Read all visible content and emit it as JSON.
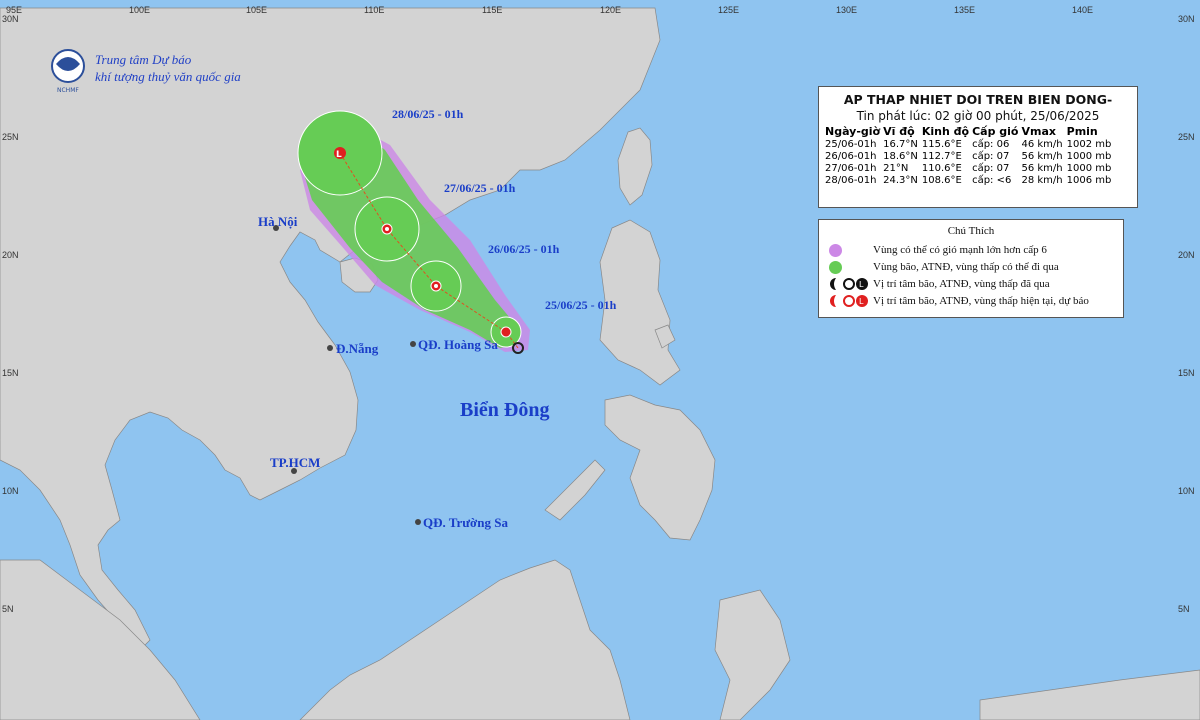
{
  "agency": {
    "name_line1": "Trung tâm Dự báo",
    "name_line2": "khí tượng thuỷ văn quốc gia",
    "logo_text": "NCHMF"
  },
  "axes": {
    "longitude_labels": [
      "95E",
      "100E",
      "105E",
      "110E",
      "115E",
      "120E",
      "125E",
      "130E",
      "135E",
      "140E"
    ],
    "latitude_labels": [
      "30N",
      "25N",
      "20N",
      "15N",
      "10N",
      "5N"
    ]
  },
  "info": {
    "title": "AP THAP NHIET DOI TREN BIEN DONG-",
    "issued": "Tin phát lúc: 02 giờ 00 phút, 25/06/2025",
    "headers": [
      "Ngày-giờ",
      "Vĩ độ",
      "Kinh độ",
      "Cấp gió",
      "Vmax",
      "Pmin"
    ],
    "rows": [
      [
        "25/06-01h",
        "16.7°N",
        "115.6°E",
        "cấp: 06",
        "46 km/h",
        "1002 mb"
      ],
      [
        "26/06-01h",
        "18.6°N",
        "112.7°E",
        "cấp: 07",
        "56 km/h",
        "1000 mb"
      ],
      [
        "27/06-01h",
        "21°N",
        "110.6°E",
        "cấp: 07",
        "56 km/h",
        "1000 mb"
      ],
      [
        "28/06-01h",
        "24.3°N",
        "108.6°E",
        "cấp: <6",
        "28 km/h",
        "1006 mb"
      ]
    ]
  },
  "legend": {
    "title": "Chú Thích",
    "items": [
      {
        "text": "Vùng có thể có gió mạnh lớn hơn cấp 6",
        "color": "#cc88e6"
      },
      {
        "text": "Vùng bão, ATNĐ, vùng thấp có thể đi qua",
        "color": "#66cc55"
      },
      {
        "text": "Vị trí tâm bão, ATNĐ, vùng thấp đã qua",
        "color": "#111111"
      },
      {
        "text": "Vị trí tâm bão, ATNĐ, vùng thấp hiện tại, dự báo",
        "color": "#e02020"
      }
    ]
  },
  "track_labels": [
    "28/06/25 - 01h",
    "27/06/25 - 01h",
    "26/06/25 - 01h",
    "25/06/25 - 01h"
  ],
  "places": {
    "hanoi": "Hà Nội",
    "danang": "Đ.Nẵng",
    "hoangsa": "QĐ. Hoàng Sa",
    "hcm": "TP.HCM",
    "truongsa": "QĐ. Trường Sa",
    "sea": "Biển Đông"
  },
  "colors": {
    "ocean": "#8fc4f0",
    "land": "#d3d3d3",
    "wind_zone": "#cc88e6",
    "storm_zone": "#66cc55",
    "center": "#e02020"
  }
}
